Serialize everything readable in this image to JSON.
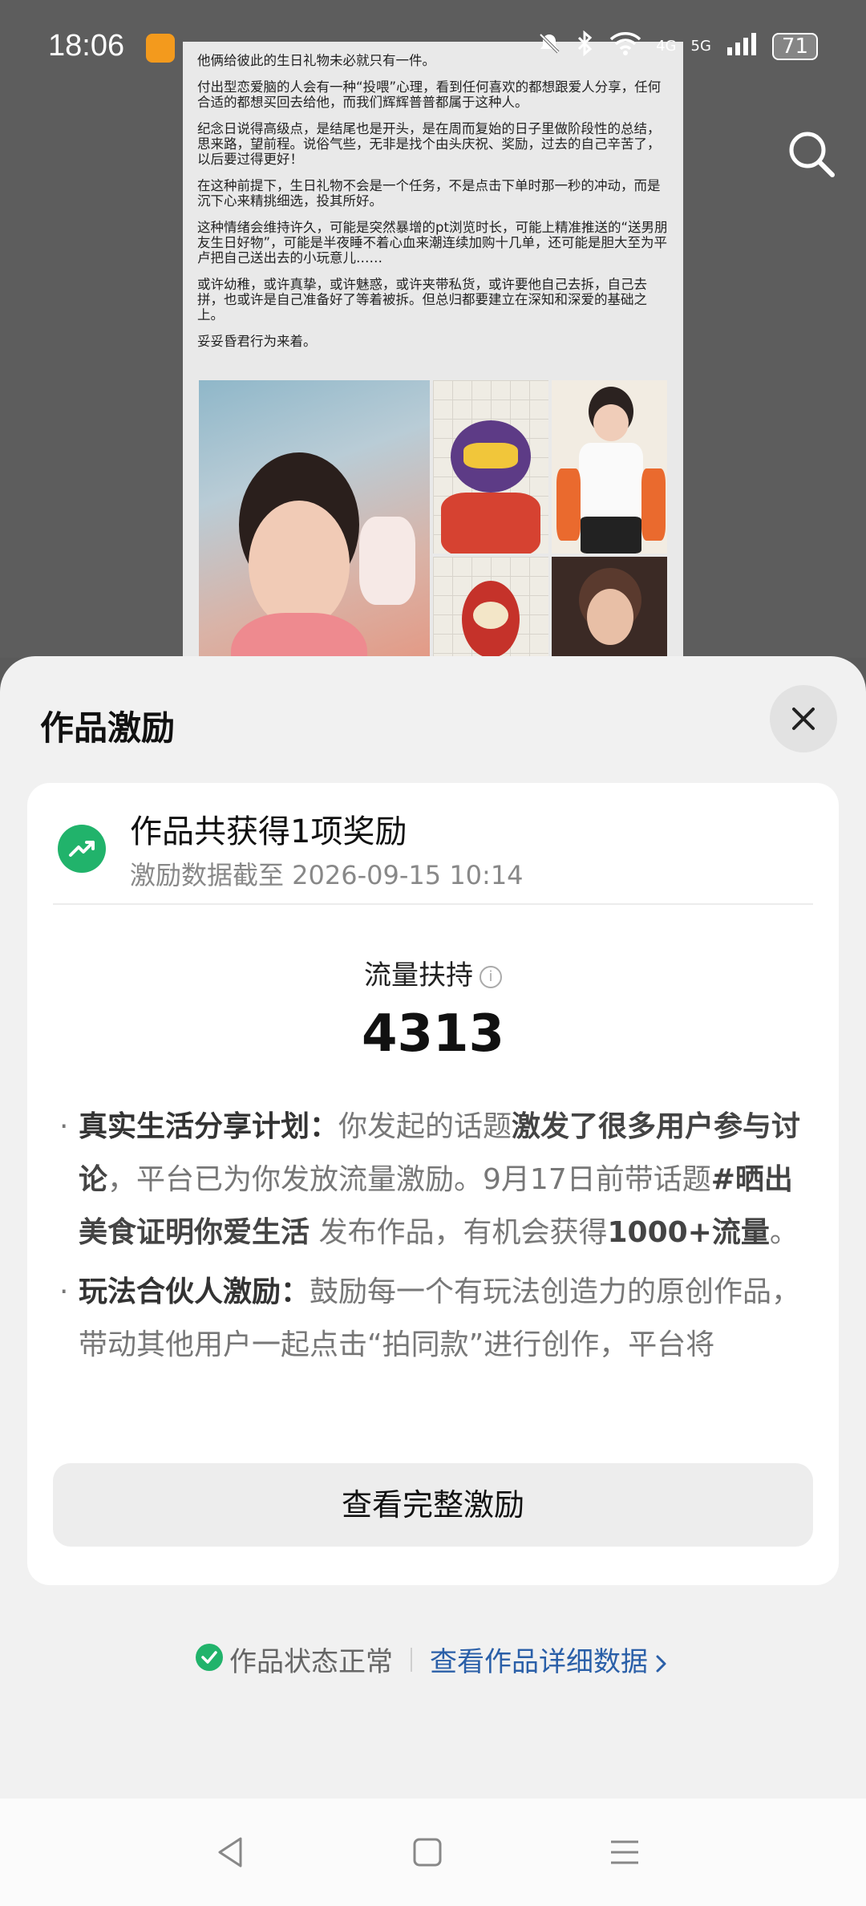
{
  "status_bar": {
    "time": "18:06",
    "network_4g": "4G",
    "network_5g": "5G",
    "battery": "71",
    "icons": [
      "mute-icon",
      "bluetooth-icon",
      "wifi-icon",
      "signal-icon",
      "battery-icon"
    ]
  },
  "post": {
    "paragraphs": [
      "他俩给彼此的生日礼物未必就只有一件。",
      "付出型恋爱脑的人会有一种“投喂”心理，看到任何喜欢的都想跟爱人分享，任何合适的都想买回去给他，而我们辉辉普普都属于这种人。",
      "纪念日说得高级点，是结尾也是开头，是在周而复始的日子里做阶段性的总结，思来路，望前程。说俗气些，无非是找个由头庆祝、奖励，过去的自己辛苦了，以后要过得更好！",
      "在这种前提下，生日礼物不会是一个任务，不是点击下单时那一秒的冲动，而是沉下心来精挑细选，投其所好。",
      "这种情绪会维持许久，可能是突然暴增的pt浏览时长，可能上精准推送的“送男朋友生日好物”，可能是半夜睡不着心血来潮连续加购十几单，还可能是胆大至为平卢把自己送出去的小玩意儿……",
      "或许幼稚，或许真挚，或许魅惑，或许夹带私货，或许要他自己去拆，自己去拼，也或许是自己准备好了等着被拆。但总归都要建立在深知和深爱的基础之上。",
      "妥妥昏君行为来着。"
    ]
  },
  "sheet": {
    "title": "作品激励",
    "card": {
      "reward_title": "作品共获得1项奖励",
      "reward_subtitle": "激励数据截至 2026-09-15 10:14",
      "metric_label": "流量扶持",
      "metric_value": "4313",
      "items": [
        {
          "name": "真实生活分享计划：",
          "text_1": "你发起的话题",
          "bold_1": "激发了很多用户参与讨论",
          "text_2": "，平台已为你发放流量激励。9月17日前带话题",
          "bold_2": "#晒出美食证明你爱生活",
          "text_3": " 发布作品，有机会获得",
          "bold_3": "1000+流量",
          "text_4": "。"
        },
        {
          "name": "玩法合伙人激励：",
          "text_1": "鼓励每一个有玩法创造力的原创作品，带动其他用户一起点击“拍同款”进行创作，平台将"
        }
      ],
      "full_button": "查看完整激励"
    },
    "footer": {
      "status": "作品状态正常",
      "detail_link": "查看作品详细数据"
    }
  },
  "colors": {
    "accent_green": "#21b36b",
    "link_blue": "#2a5fa8",
    "sheet_bg": "#f1f1f1"
  }
}
